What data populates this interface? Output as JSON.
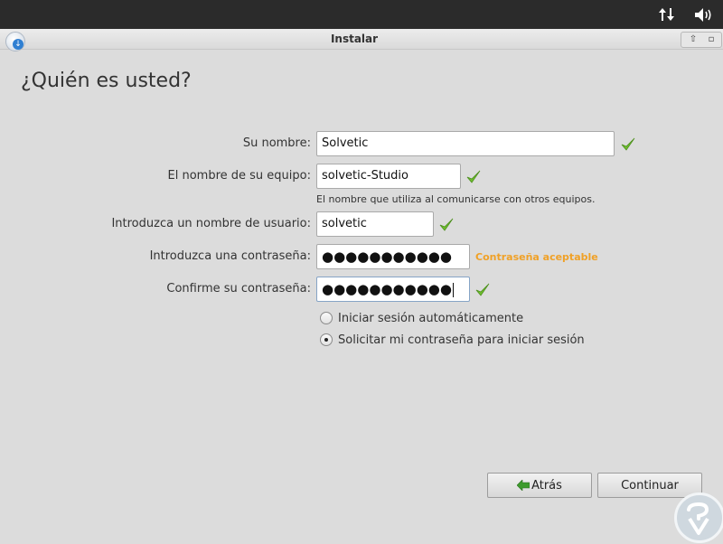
{
  "window": {
    "title": "Instalar"
  },
  "page": {
    "heading": "¿Quién es usted?"
  },
  "form": {
    "name": {
      "label": "Su nombre:",
      "value": "Solvetic"
    },
    "computer": {
      "label": "El nombre de su equipo:",
      "value": "solvetic-Studio",
      "hint": "El nombre que utiliza al comunicarse con otros equipos."
    },
    "username": {
      "label": "Introduzca un nombre de usuario:",
      "value": "solvetic"
    },
    "password": {
      "label": "Introduzca una contraseña:",
      "value": "●●●●●●●●●●●",
      "strength": "Contraseña aceptable"
    },
    "confirm": {
      "label": "Confirme su contraseña:",
      "value": "●●●●●●●●●●●"
    },
    "login_options": [
      {
        "label": "Iniciar sesión automáticamente",
        "selected": false
      },
      {
        "label": "Solicitar mi contraseña para iniciar sesión",
        "selected": true
      }
    ]
  },
  "buttons": {
    "back": "Atrás",
    "continue": "Continuar"
  },
  "colors": {
    "topbar": "#2b2b2b",
    "check": "#6fbf2e",
    "strength": "#f0a127",
    "back_arrow": "#3d9b2c"
  },
  "icons": [
    "network-arrows-icon",
    "volume-icon",
    "installer-icon",
    "check-icon",
    "back-arrow-icon",
    "solvetic-logo"
  ]
}
